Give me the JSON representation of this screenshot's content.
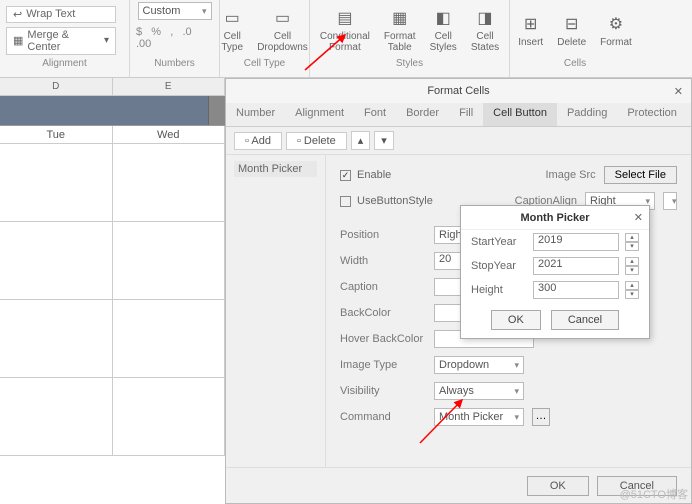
{
  "ribbon": {
    "wrap_text": "Wrap Text",
    "merge_center": "Merge & Center",
    "alignment_label": "Alignment",
    "number_format": "Custom",
    "numbers_label": "Numbers",
    "cell_type": "Cell Type",
    "cell_dropdowns": "Cell\nDropdowns",
    "cell_type_label": "Cell Type",
    "conditional_format": "Conditional\nFormat",
    "format_table": "Format\nTable",
    "cell_styles": "Cell Styles",
    "cell_states": "Cell States",
    "styles_label": "Styles",
    "insert": "Insert",
    "delete": "Delete",
    "format": "Format",
    "cells_label": "Cells"
  },
  "sheet": {
    "col_d": "D",
    "col_e": "E",
    "day_tue": "Tue",
    "day_wed": "Wed"
  },
  "dialog": {
    "title": "Format Cells",
    "tabs": [
      "Number",
      "Alignment",
      "Font",
      "Border",
      "Fill",
      "Cell Button",
      "Padding",
      "Protection"
    ],
    "active_tab": 5,
    "add": "Add",
    "delete": "Delete",
    "side_item": "Month Picker",
    "enable": "Enable",
    "use_button_style": "UseButtonStyle",
    "image_src": "Image Src",
    "select_file": "Select File",
    "caption_align_lbl": "CaptionAlign",
    "caption_align_val": "Right",
    "position_lbl": "Position",
    "position_val": "Right",
    "width_lbl": "Width",
    "width_val": "20",
    "caption_lbl": "Caption",
    "backcolor_lbl": "BackColor",
    "hover_backcolor_lbl": "Hover BackColor",
    "image_type_lbl": "Image Type",
    "image_type_val": "Dropdown",
    "visibility_lbl": "Visibility",
    "visibility_val": "Always",
    "command_lbl": "Command",
    "command_val": "Month Picker",
    "ok": "OK",
    "cancel": "Cancel"
  },
  "popup": {
    "title": "Month Picker",
    "start_year_lbl": "StartYear",
    "start_year_val": "2019",
    "stop_year_lbl": "StopYear",
    "stop_year_val": "2021",
    "height_lbl": "Height",
    "height_val": "300",
    "ok": "OK",
    "cancel": "Cancel"
  },
  "watermark": "@51CTO博客"
}
